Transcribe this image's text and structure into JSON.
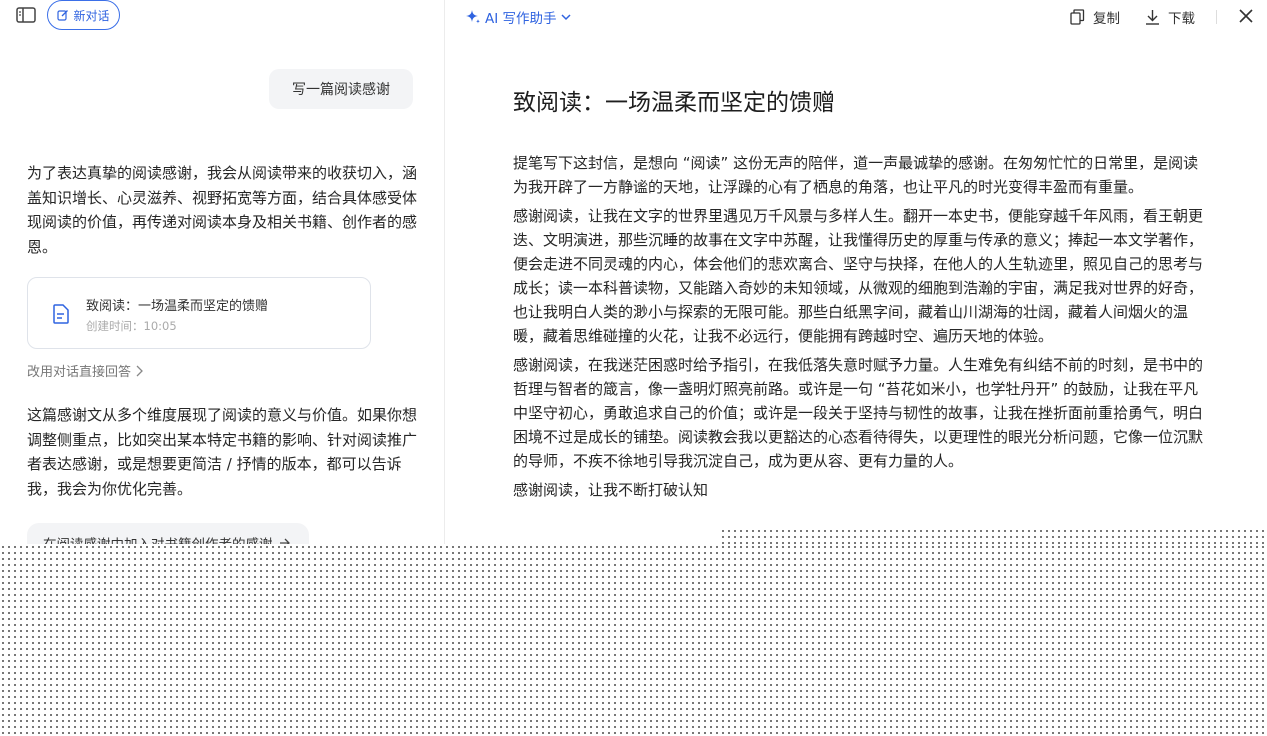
{
  "sidebar": {
    "toggle_icon": "sidebar-panel-icon",
    "new_chat_label": "新对话"
  },
  "chat": {
    "user_message": "写一篇阅读感谢",
    "ai_intro": "为了表达真挚的阅读感谢，我会从阅读带来的收获切入，涵盖知识增长、心灵滋养、视野拓宽等方面，结合具体感受体现阅读的价值，再传递对阅读本身及相关书籍、创作者的感恩。",
    "doc_card": {
      "title": "致阅读：一场温柔而坚定的馈赠",
      "time": "创建时间：10:05"
    },
    "switch_label": "改用对话直接回答",
    "ai_followup": "这篇感谢文从多个维度展现了阅读的意义与价值。如果你想调整侧重点，比如突出某本特定书籍的影响、针对阅读推广者表达感谢，或是想要更简洁 / 抒情的版本，都可以告诉我，我会为你优化完善。",
    "suggestion": "在阅读感谢中加入对书籍创作者的感谢"
  },
  "writer": {
    "menu_label": "AI 写作助手",
    "copy_label": "复制",
    "download_label": "下载",
    "title": "致阅读：一场温柔而坚定的馈赠",
    "paragraphs": [
      "提笔写下这封信，是想向 “阅读” 这份无声的陪伴，道一声最诚挚的感谢。在匆匆忙忙的日常里，是阅读为我开辟了一方静谧的天地，让浮躁的心有了栖息的角落，也让平凡的时光变得丰盈而有重量。",
      "感谢阅读，让我在文字的世界里遇见万千风景与多样人生。翻开一本史书，便能穿越千年风雨，看王朝更迭、文明演进，那些沉睡的故事在文字中苏醒，让我懂得历史的厚重与传承的意义；捧起一本文学著作，便会走进不同灵魂的内心，体会他们的悲欢离合、坚守与抉择，在他人的人生轨迹里，照见自己的思考与成长；读一本科普读物，又能踏入奇妙的未知领域，从微观的细胞到浩瀚的宇宙，满足我对世界的好奇，也让我明白人类的渺小与探索的无限可能。那些白纸黑字间，藏着山川湖海的壮阔，藏着人间烟火的温暖，藏着思维碰撞的火花，让我不必远行，便能拥有跨越时空、遍历天地的体验。",
      "感谢阅读，在我迷茫困惑时给予指引，在我低落失意时赋予力量。人生难免有纠结不前的时刻，是书中的哲理与智者的箴言，像一盏明灯照亮前路。或许是一句 “苔花如米小，也学牡丹开” 的鼓励，让我在平凡中坚守初心，勇敢追求自己的价值；或许是一段关于坚持与韧性的故事，让我在挫折面前重拾勇气，明白困境不过是成长的铺垫。阅读教会我以更豁达的心态看待得失，以更理性的眼光分析问题，它像一位沉默的导师，不疾不徐地引导我沉淀自己，成为更从容、更有力量的人。",
      "感谢阅读，让我不断打破认知"
    ]
  },
  "colors": {
    "accent": "#2f63e0",
    "bubble_bg": "#f3f4f6"
  }
}
